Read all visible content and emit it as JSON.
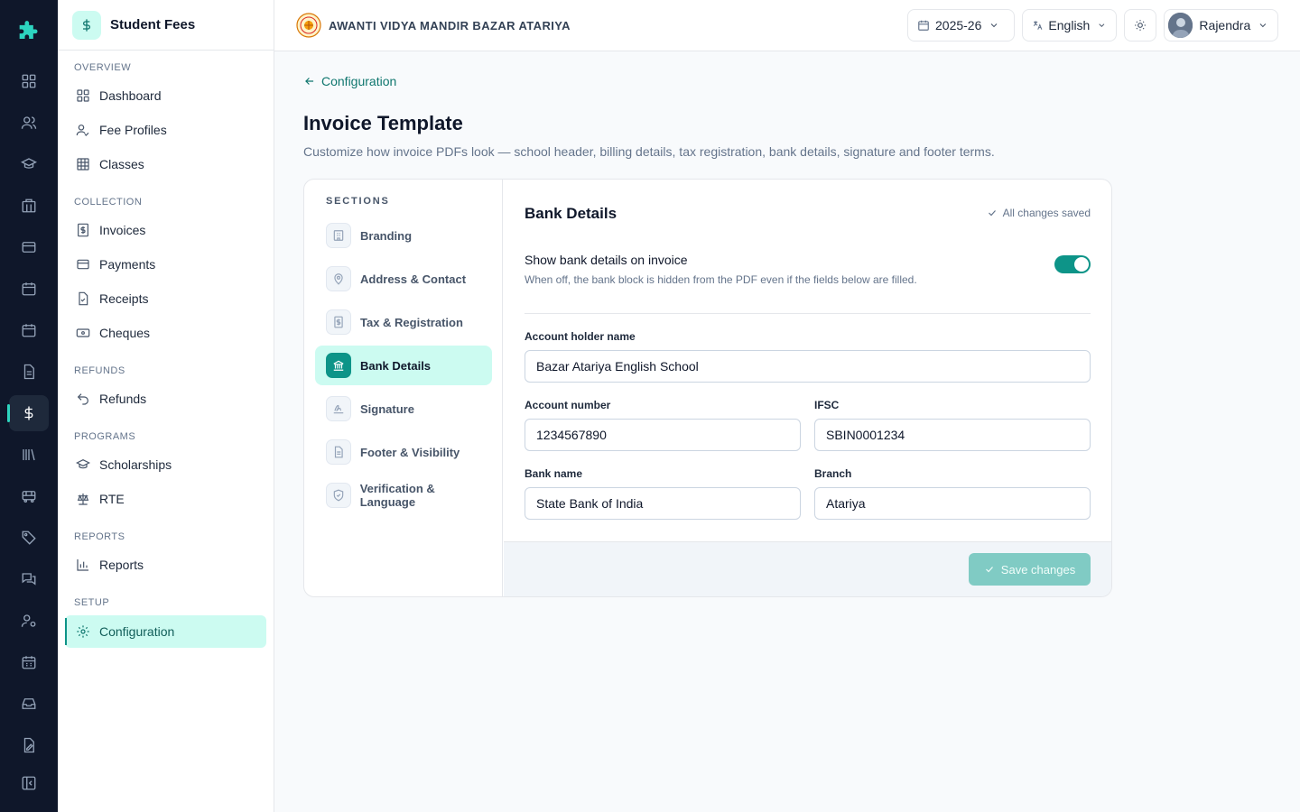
{
  "app": {
    "module_title": "Student Fees",
    "school_name": "AWANTI VIDYA MANDIR BAZAR ATARIYA"
  },
  "rail": {
    "icons": [
      "puzzle-logo-icon",
      "grid-icon",
      "users-icon",
      "graduation-cap-icon",
      "building-icon",
      "card-icon",
      "calendar-icon",
      "calendar-alt-icon",
      "document-icon",
      "dollar-icon",
      "library-icon",
      "bus-icon",
      "tag-icon",
      "chat-icon",
      "user-cog-icon",
      "calendar-grid-icon",
      "inbox-icon",
      "file-edit-icon",
      "panel-collapse-icon"
    ],
    "active": "dollar-icon"
  },
  "sidebar": {
    "sections": [
      {
        "label": "OVERVIEW",
        "items": [
          "Dashboard",
          "Fee Profiles",
          "Classes"
        ]
      },
      {
        "label": "COLLECTION",
        "items": [
          "Invoices",
          "Payments",
          "Receipts",
          "Cheques"
        ]
      },
      {
        "label": "REFUNDS",
        "items": [
          "Refunds"
        ]
      },
      {
        "label": "PROGRAMS",
        "items": [
          "Scholarships",
          "RTE"
        ]
      },
      {
        "label": "REPORTS",
        "items": [
          "Reports"
        ]
      },
      {
        "label": "SETUP",
        "items": [
          "Configuration"
        ]
      }
    ],
    "active_item": "Configuration"
  },
  "topbar": {
    "year": "2025-26",
    "language": "English",
    "user": "Rajendra"
  },
  "page": {
    "back_label": "Configuration",
    "title": "Invoice Template",
    "subtitle": "Customize how invoice PDFs look — school header, billing details, tax registration, bank details, signature and footer terms."
  },
  "sections": {
    "label": "SECTIONS",
    "items": [
      "Branding",
      "Address & Contact",
      "Tax & Registration",
      "Bank Details",
      "Signature",
      "Footer & Visibility",
      "Verification & Language"
    ],
    "active": "Bank Details"
  },
  "bank": {
    "title": "Bank Details",
    "saved_status": "All changes saved",
    "toggle_label": "Show bank details on invoice",
    "toggle_help": "When off, the bank block is hidden from the PDF even if the fields below are filled.",
    "toggle_on": true,
    "fields": {
      "holder_label": "Account holder name",
      "holder_value": "Bazar Atariya English School",
      "account_label": "Account number",
      "account_value": "1234567890",
      "ifsc_label": "IFSC",
      "ifsc_value": "SBIN0001234",
      "bank_label": "Bank name",
      "bank_value": "State Bank of India",
      "branch_label": "Branch",
      "branch_value": "Atariya"
    },
    "save_label": "Save changes"
  },
  "colors": {
    "accent": "#0d9488",
    "accent_light": "#ccfbf1",
    "rail_bg": "#0f172a"
  }
}
